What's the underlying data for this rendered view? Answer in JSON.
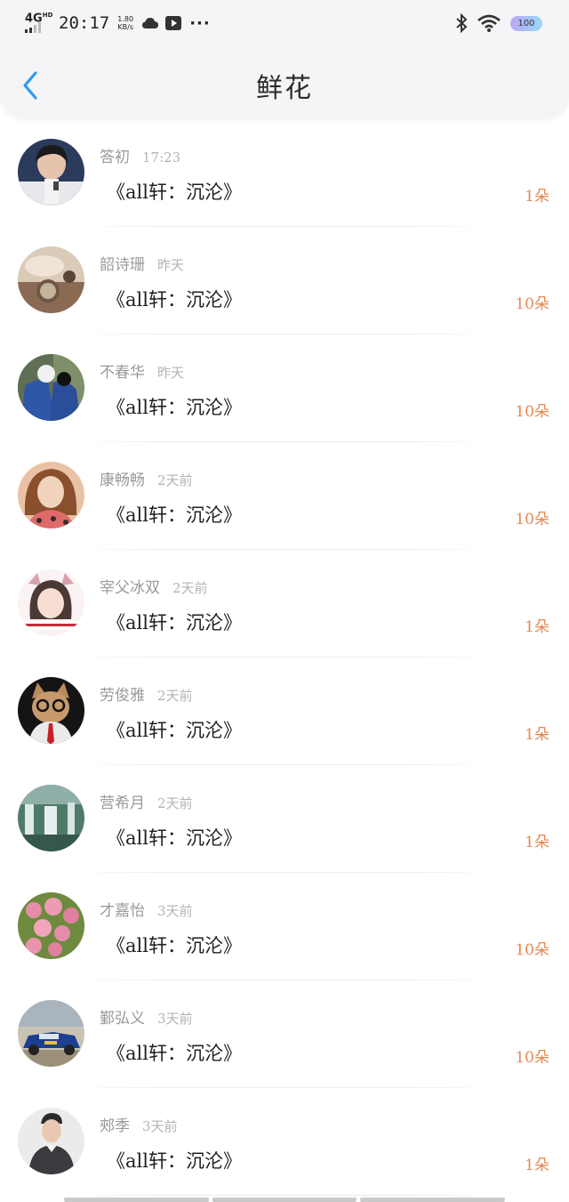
{
  "status_bar": {
    "network": "4G",
    "network_sup": "HD",
    "time": "20:17",
    "speed_value": "1.80",
    "speed_unit": "KB/s",
    "battery": "100"
  },
  "header": {
    "title": "鲜花",
    "back_icon": "chevron-left-icon",
    "accent_color": "#2d9bf0"
  },
  "colors": {
    "count": "#e5884f",
    "username": "#9a9a9a",
    "title": "#1f1f1f"
  },
  "items": [
    {
      "username": "答初",
      "time": "17:23",
      "title": "《all轩：沉沦》",
      "count": "1朵",
      "avatar": "person-portrait"
    },
    {
      "username": "韶诗珊",
      "time": "昨天",
      "title": "《all轩：沉沦》",
      "count": "10朵",
      "avatar": "pocket-watch-photo"
    },
    {
      "username": "不春华",
      "time": "昨天",
      "title": "《all轩：沉沦》",
      "count": "10朵",
      "avatar": "denim-outfit-photo"
    },
    {
      "username": "康畅畅",
      "time": "2天前",
      "title": "《all轩：沉沦》",
      "count": "10朵",
      "avatar": "woman-portrait"
    },
    {
      "username": "宰父冰双",
      "time": "2天前",
      "title": "《all轩：沉沦》",
      "count": "1朵",
      "avatar": "cartoon-girl-photo"
    },
    {
      "username": "劳俊雅",
      "time": "2天前",
      "title": "《all轩：沉沦》",
      "count": "1朵",
      "avatar": "cat-with-glasses-photo"
    },
    {
      "username": "营希月",
      "time": "2天前",
      "title": "《all轩：沉沦》",
      "count": "1朵",
      "avatar": "waterfall-photo"
    },
    {
      "username": "才嘉怡",
      "time": "3天前",
      "title": "《all轩：沉沦》",
      "count": "10朵",
      "avatar": "pink-flowers-photo"
    },
    {
      "username": "鄞弘义",
      "time": "3天前",
      "title": "《all轩：沉沦》",
      "count": "10朵",
      "avatar": "rally-car-photo"
    },
    {
      "username": "郟季",
      "time": "3天前",
      "title": "《all轩：沉沦》",
      "count": "1朵",
      "avatar": "man-portrait"
    }
  ]
}
